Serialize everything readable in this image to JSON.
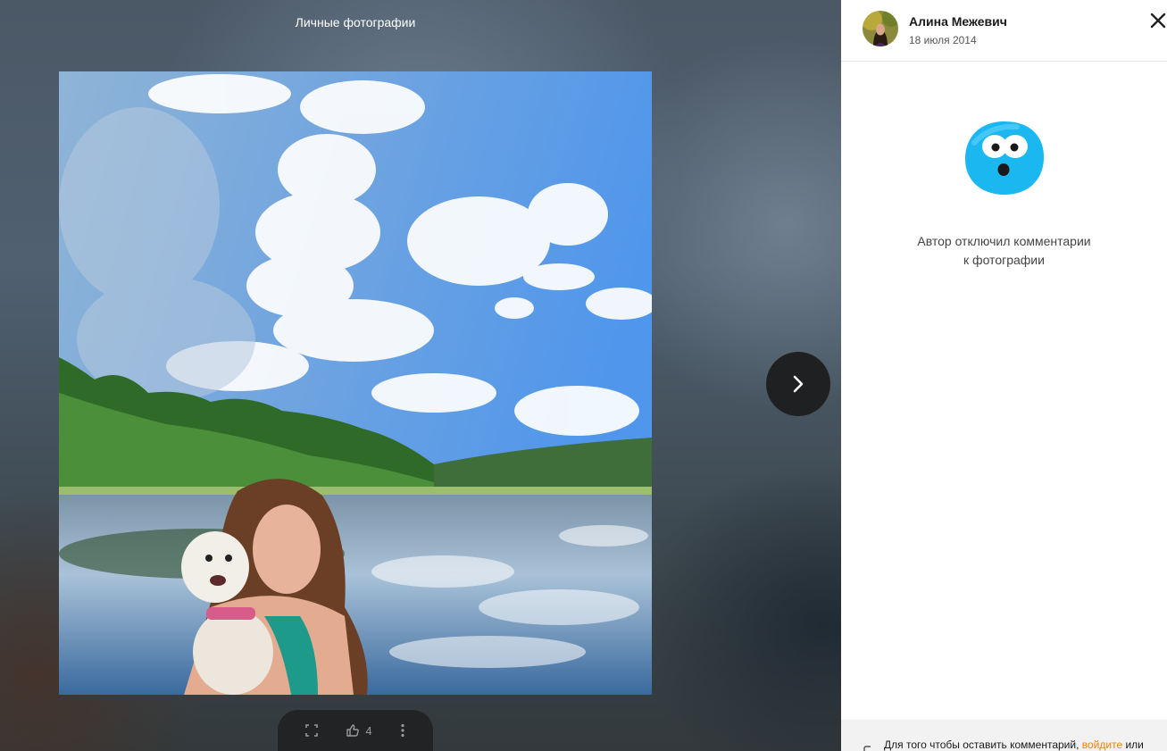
{
  "viewer": {
    "album_title": "Личные фотографии",
    "likes_count": "4"
  },
  "author": {
    "name": "Алина Межевич",
    "date": "18 июля 2014"
  },
  "comments": {
    "disabled_line1": "Автор отключил комментарии",
    "disabled_line2": "к фотографии",
    "footer_prefix": "Для того чтобы оставить комментарий,",
    "footer_link": "войдите",
    "footer_suffix": "или"
  },
  "icons": {
    "next": "chevron-right-icon",
    "fullscreen": "fullscreen-icon",
    "like": "thumbs-up-icon",
    "more": "more-vertical-icon",
    "close": "close-icon",
    "mascot": "surprised-face-icon"
  },
  "colors": {
    "accent_orange": "#ee8208",
    "mascot_blue": "#1ab7f0"
  }
}
